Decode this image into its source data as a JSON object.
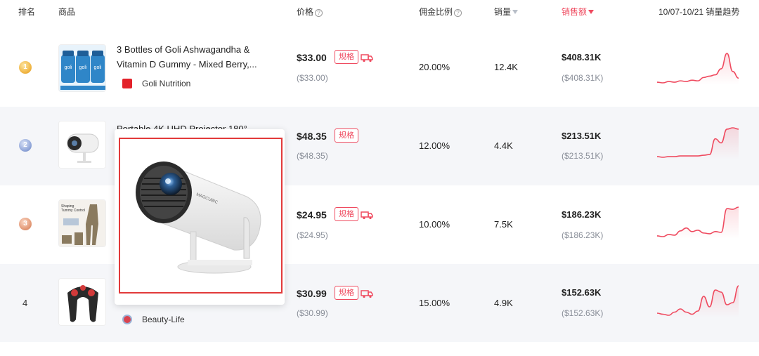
{
  "header": {
    "rank": "排名",
    "product": "商品",
    "price": "价格",
    "commission": "佣金比例",
    "sales": "销量",
    "gmv": "销售额",
    "trend": "10/07-10/21 销量趋势"
  },
  "colors": {
    "accent": "#ef4a5f",
    "gold": "#f0b440",
    "silver": "#8ea4d8",
    "bronze": "#e29774"
  },
  "rows": [
    {
      "rank": "1",
      "title": "3 Bottles of Goli Ashwagandha & Vitamin D Gummy - Mixed Berry,...",
      "brand": "Goli Nutrition",
      "price": "$33.00",
      "price_sub": "($33.00)",
      "spec": "规格",
      "commission": "20.00%",
      "sales": "12.4K",
      "gmv": "$408.31K",
      "gmv_sub": "($408.31K)",
      "trend": [
        2,
        1,
        3,
        2,
        4,
        3,
        5,
        4,
        9,
        11,
        13,
        22,
        45,
        18,
        8
      ]
    },
    {
      "rank": "2",
      "title": "Portable 4K UHD Projector 180°",
      "brand": "",
      "price": "$48.35",
      "price_sub": "($48.35)",
      "spec": "规格",
      "commission": "12.00%",
      "sales": "4.4K",
      "gmv": "$213.51K",
      "gmv_sub": "($213.51K)",
      "trend": [
        2,
        1,
        2,
        2,
        3,
        3,
        3,
        3,
        4,
        5,
        28,
        22,
        42,
        44,
        42
      ]
    },
    {
      "rank": "3",
      "title": "",
      "brand": "",
      "price": "$24.95",
      "price_sub": "($24.95)",
      "spec": "规格",
      "commission": "10.00%",
      "sales": "7.5K",
      "gmv": "$186.23K",
      "gmv_sub": "($186.23K)",
      "trend": [
        4,
        3,
        6,
        5,
        11,
        15,
        10,
        12,
        8,
        7,
        10,
        9,
        42,
        41,
        44
      ]
    },
    {
      "rank": "4",
      "title": "",
      "brand": "Beauty-Life",
      "price": "$30.99",
      "price_sub": "($30.99)",
      "spec": "规格",
      "commission": "15.00%",
      "sales": "4.9K",
      "gmv": "$152.63K",
      "gmv_sub": "($152.63K)",
      "trend": [
        4,
        3,
        2,
        5,
        8,
        5,
        3,
        6,
        20,
        10,
        26,
        24,
        12,
        14,
        30
      ]
    }
  ]
}
